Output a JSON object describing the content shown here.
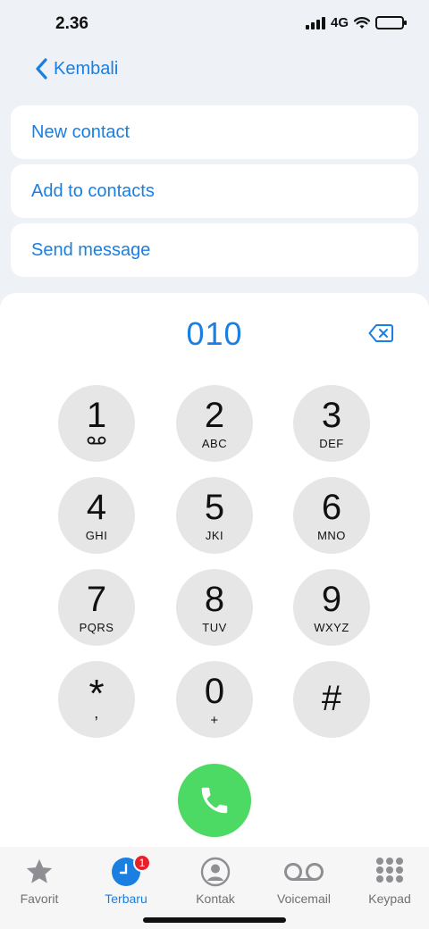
{
  "status_bar": {
    "time": "2.36",
    "network": "4G"
  },
  "nav": {
    "back_label": "Kembali"
  },
  "actions": [
    {
      "label": "New contact"
    },
    {
      "label": "Add to contacts"
    },
    {
      "label": "Send message"
    }
  ],
  "dialer": {
    "number": "010",
    "keys": [
      {
        "digit": "1",
        "letters": "",
        "sub_icon": "voicemail-icon"
      },
      {
        "digit": "2",
        "letters": "ABC"
      },
      {
        "digit": "3",
        "letters": "DEF"
      },
      {
        "digit": "4",
        "letters": "GHI"
      },
      {
        "digit": "5",
        "letters": "JKI"
      },
      {
        "digit": "6",
        "letters": "MNO"
      },
      {
        "digit": "7",
        "letters": "PQRS"
      },
      {
        "digit": "8",
        "letters": "TUV"
      },
      {
        "digit": "9",
        "letters": "WXYZ"
      },
      {
        "digit": "*",
        "letters": ","
      },
      {
        "digit": "0",
        "letters": "+"
      },
      {
        "digit": "#",
        "letters": ""
      }
    ]
  },
  "tabs": [
    {
      "label": "Favorit",
      "icon": "star-icon",
      "active": false
    },
    {
      "label": "Terbaru",
      "icon": "clock-icon",
      "active": true,
      "badge": "1"
    },
    {
      "label": "Kontak",
      "icon": "person-icon",
      "active": false
    },
    {
      "label": "Voicemail",
      "icon": "voicemail-icon",
      "active": false
    },
    {
      "label": "Keypad",
      "icon": "keypad-icon",
      "active": false
    }
  ],
  "colors": {
    "accent": "#1a7fe0",
    "call": "#4cd964",
    "badge": "#e8202a"
  }
}
